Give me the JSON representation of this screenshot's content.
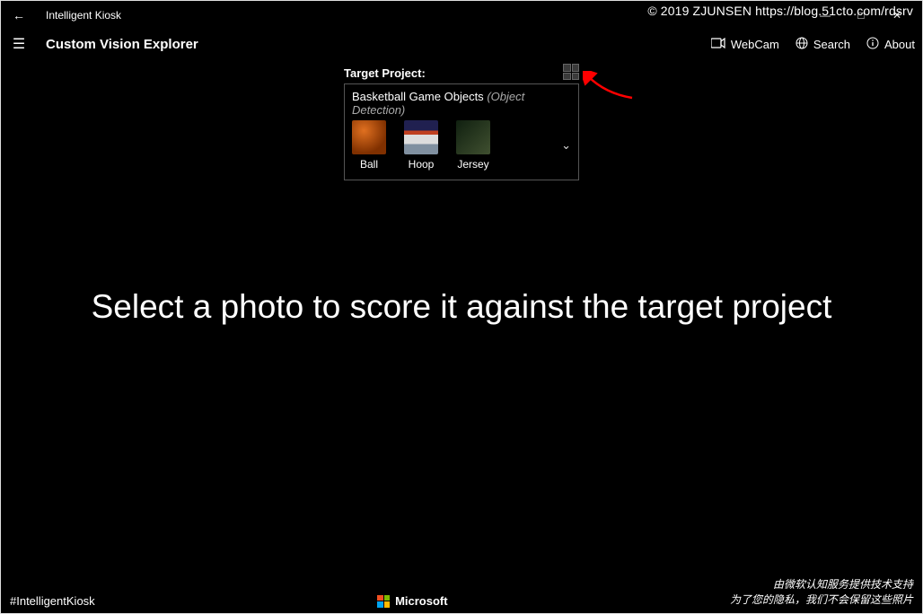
{
  "watermark": "© 2019 ZJUNSEN https://blog.51cto.com/rdsrv",
  "titlebar": {
    "title": "Intelligent Kiosk"
  },
  "header": {
    "page_title": "Custom Vision Explorer",
    "actions": {
      "webcam": "WebCam",
      "search": "Search",
      "about": "About"
    }
  },
  "project": {
    "label": "Target Project:",
    "name": "Basketball Game Objects",
    "type": "(Object Detection)",
    "tags": [
      {
        "label": "Ball"
      },
      {
        "label": "Hoop"
      },
      {
        "label": "Jersey"
      }
    ]
  },
  "main_prompt": "Select a photo to score it against the target project",
  "footer": {
    "hashtag": "#IntelligentKiosk",
    "brand": "Microsoft",
    "disclaimer_line1": "由微软认知服务提供技术支持",
    "disclaimer_line2": "为了您的隐私，我们不会保留这些照片"
  }
}
